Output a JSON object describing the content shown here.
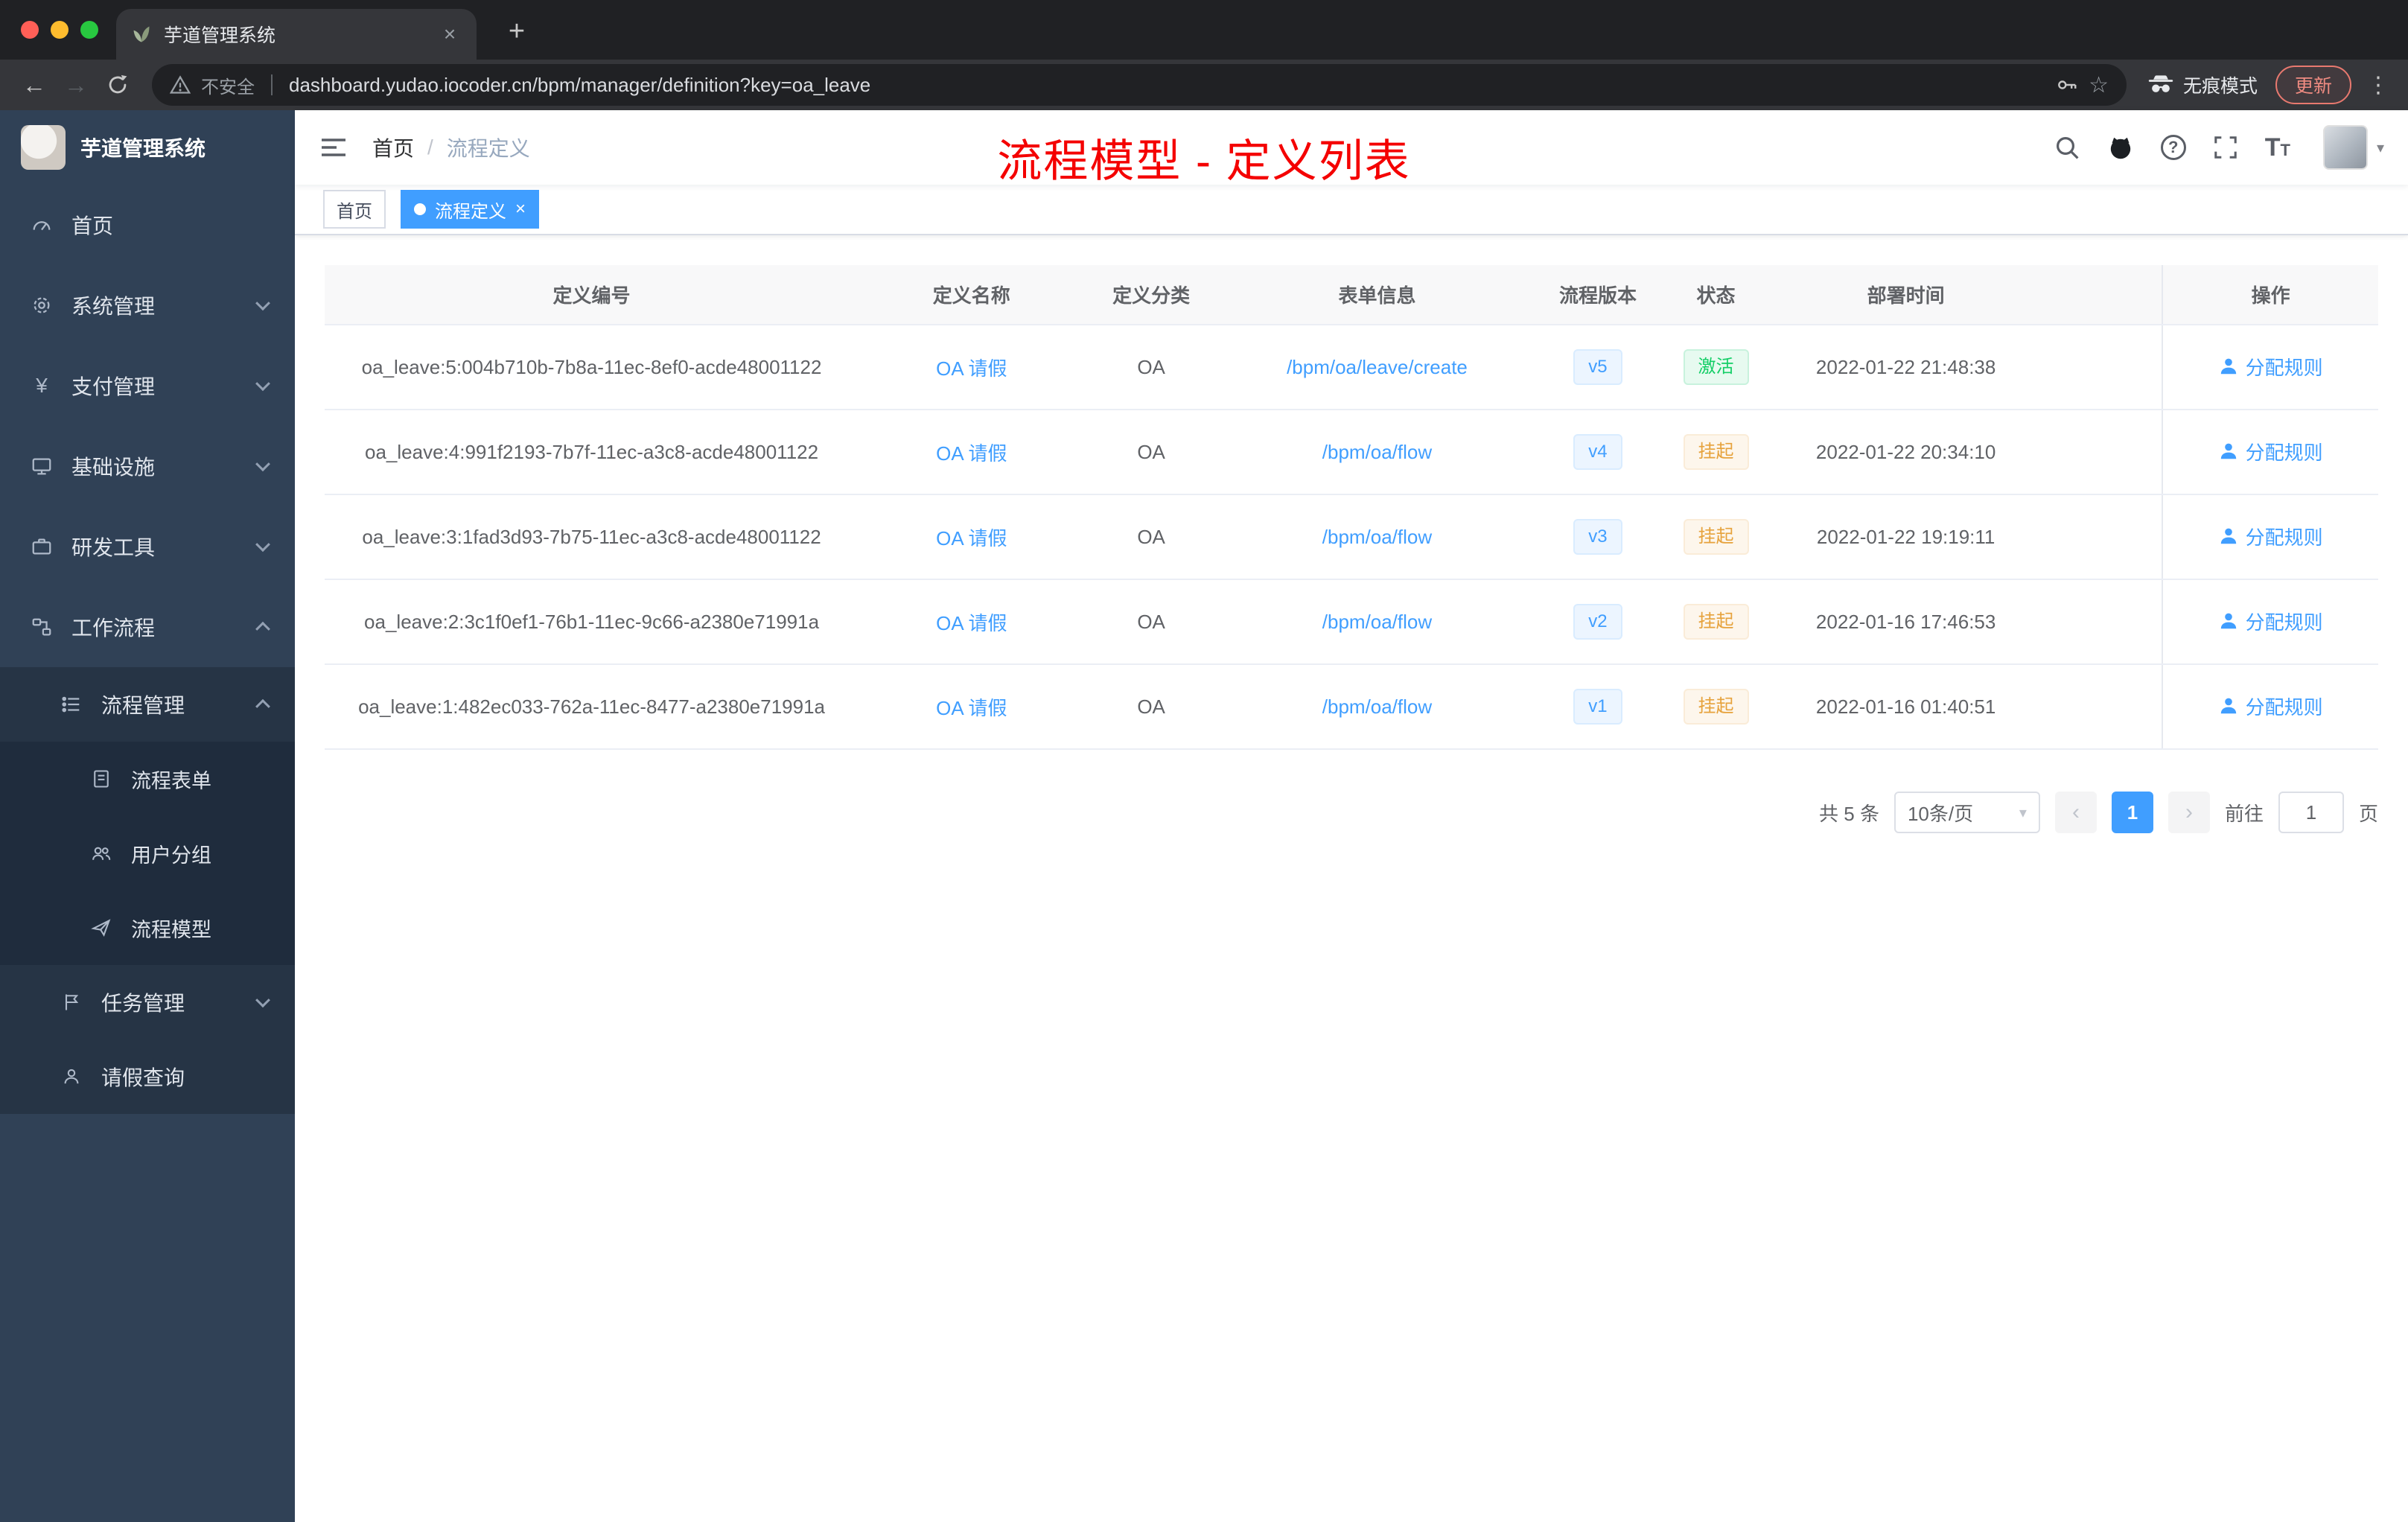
{
  "colors": {
    "accent": "#409eff",
    "annotation_red": "#f40000",
    "success_green": "#13ce66",
    "warning_orange": "#e6a23c",
    "sidebar_bg": "#304156"
  },
  "icons": {
    "back": "←",
    "forward": "→",
    "star": "☆",
    "kebab": "⋮",
    "new_tab": "+",
    "close": "×",
    "question": "?",
    "prev": "‹",
    "next": "›",
    "caret_down": "▾",
    "font_t": "T",
    "yen": "¥"
  },
  "browser": {
    "tab_title": "芋道管理系统",
    "security_label": "不安全",
    "url": "dashboard.yudao.iocoder.cn/bpm/manager/definition?key=oa_leave",
    "incognito_label": "无痕模式",
    "update_label": "更新"
  },
  "sidebar": {
    "logo_title": "芋道管理系统",
    "menu": [
      {
        "label": "首页"
      },
      {
        "label": "系统管理"
      },
      {
        "label": "支付管理"
      },
      {
        "label": "基础设施"
      },
      {
        "label": "研发工具"
      },
      {
        "label": "工作流程"
      }
    ],
    "process_management": {
      "label": "流程管理"
    },
    "process_children": [
      {
        "label": "流程表单"
      },
      {
        "label": "用户分组"
      },
      {
        "label": "流程模型"
      }
    ],
    "task_management": {
      "label": "任务管理"
    },
    "leave_query": {
      "label": "请假查询"
    }
  },
  "navbar": {
    "breadcrumb_home": "首页",
    "breadcrumb_separator": "/",
    "breadcrumb_current": "流程定义",
    "annotation": "流程模型 - 定义列表"
  },
  "tags": {
    "home": "首页",
    "active": "流程定义"
  },
  "table": {
    "columns": {
      "id": "定义编号",
      "name": "定义名称",
      "category": "定义分类",
      "form": "表单信息",
      "version": "流程版本",
      "status": "状态",
      "time": "部署时间",
      "action": "操作"
    },
    "rows": [
      {
        "id": "oa_leave:5:004b710b-7b8a-11ec-8ef0-acde48001122",
        "name": "OA 请假",
        "category": "OA",
        "form": "/bpm/oa/leave/create",
        "version": "v5",
        "status": "激活",
        "status_type": "success",
        "time": "2022-01-22 21:48:38",
        "action": "分配规则"
      },
      {
        "id": "oa_leave:4:991f2193-7b7f-11ec-a3c8-acde48001122",
        "name": "OA 请假",
        "category": "OA",
        "form": "/bpm/oa/flow",
        "version": "v4",
        "status": "挂起",
        "status_type": "warning",
        "time": "2022-01-22 20:34:10",
        "action": "分配规则"
      },
      {
        "id": "oa_leave:3:1fad3d93-7b75-11ec-a3c8-acde48001122",
        "name": "OA 请假",
        "category": "OA",
        "form": "/bpm/oa/flow",
        "version": "v3",
        "status": "挂起",
        "status_type": "warning",
        "time": "2022-01-22 19:19:11",
        "action": "分配规则"
      },
      {
        "id": "oa_leave:2:3c1f0ef1-76b1-11ec-9c66-a2380e71991a",
        "name": "OA 请假",
        "category": "OA",
        "form": "/bpm/oa/flow",
        "version": "v2",
        "status": "挂起",
        "status_type": "warning",
        "time": "2022-01-16 17:46:53",
        "action": "分配规则"
      },
      {
        "id": "oa_leave:1:482ec033-762a-11ec-8477-a2380e71991a",
        "name": "OA 请假",
        "category": "OA",
        "form": "/bpm/oa/flow",
        "version": "v1",
        "status": "挂起",
        "status_type": "warning",
        "time": "2022-01-16 01:40:51",
        "action": "分配规则"
      }
    ]
  },
  "pagination": {
    "total": "共 5 条",
    "page_size": "10条/页",
    "page": "1",
    "goto_prefix": "前往",
    "goto_value": "1",
    "goto_suffix": "页"
  }
}
